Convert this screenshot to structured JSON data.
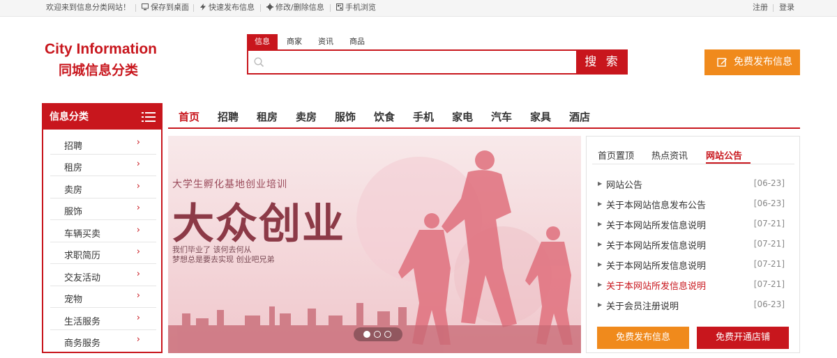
{
  "topbar": {
    "welcome": "欢迎来到信息分类网站！",
    "save_desktop": "保存到桌面",
    "quick_publish": "快速发布信息",
    "modify_delete": "修改/删除信息",
    "mobile_browse": "手机浏览",
    "register": "注册",
    "login": "登录"
  },
  "logo": {
    "english": "City Information",
    "chinese": "同城信息分类"
  },
  "search": {
    "tabs": [
      "信息",
      "商家",
      "资讯",
      "商品"
    ],
    "active_tab": "信息",
    "placeholder": "",
    "button": "搜 索"
  },
  "publish_top": "免费发布信息",
  "category": {
    "title": "信息分类",
    "items": [
      "招聘",
      "租房",
      "卖房",
      "服饰",
      "车辆买卖",
      "求职简历",
      "交友活动",
      "宠物",
      "生活服务",
      "商务服务"
    ]
  },
  "nav": {
    "items": [
      "首页",
      "招聘",
      "租房",
      "卖房",
      "服饰",
      "饮食",
      "手机",
      "家电",
      "汽车",
      "家具",
      "酒店"
    ],
    "active": "首页"
  },
  "banner": {
    "subtitle": "大学生孵化基地创业培训",
    "headline": "大众创业",
    "line1": "我们毕业了  该何去何从",
    "line2": "梦想总是要去实现  创业吧兄弟",
    "slide_count": 3,
    "current_slide": 1
  },
  "panel": {
    "tabs": [
      "首页置顶",
      "热点资讯",
      "网站公告"
    ],
    "active_tab": "网站公告",
    "news": [
      {
        "title": "网站公告",
        "date": "[06-23]"
      },
      {
        "title": "关于本网站信息发布公告",
        "date": "[06-23]"
      },
      {
        "title": "关于本网站所发信息说明",
        "date": "[07-21]"
      },
      {
        "title": "关于本网站所发信息说明",
        "date": "[07-21]"
      },
      {
        "title": "关于本网站所发信息说明",
        "date": "[07-21]"
      },
      {
        "title": "关于本网站所发信息说明",
        "date": "[07-21]",
        "highlighted": true
      },
      {
        "title": "关于会员注册说明",
        "date": "[06-23]"
      }
    ],
    "publish_button": "免费发布信息",
    "open_store_button": "免费开通店铺"
  },
  "colors": {
    "brand": "#c8161d",
    "accent": "#f08a1c"
  }
}
